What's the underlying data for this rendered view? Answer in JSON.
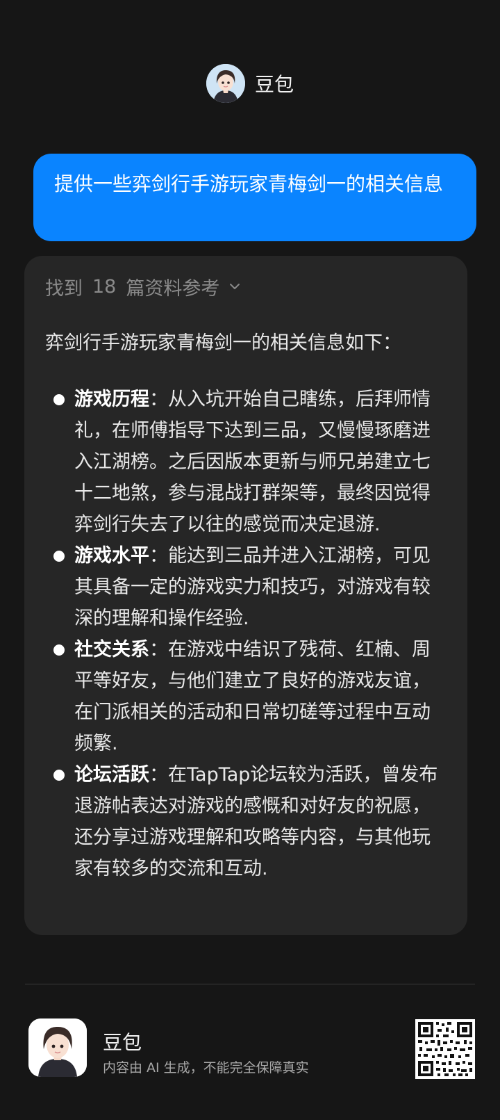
{
  "header": {
    "title": "豆包",
    "avatar_icon": "doubao-avatar-icon"
  },
  "user_message": {
    "text": "提供一些弈剑行手游玩家青梅剑一的相关信息"
  },
  "answer": {
    "refs": {
      "prefix": "找到",
      "count": "18",
      "suffix": "篇资料参考",
      "icon": "chevron-down-icon"
    },
    "intro": "弈剑行手游玩家青梅剑一的相关信息如下：",
    "bullets": [
      {
        "title": "游戏历程",
        "text": "：从入坑开始自己瞎练，后拜师情礼，在师傅指导下达到三品，又慢慢琢磨进入江湖榜。之后因版本更新与师兄弟建立七十二地煞，参与混战打群架等，最终因觉得弈剑行失去了以往的感觉而决定退游."
      },
      {
        "title": "游戏水平",
        "text": "：能达到三品并进入江湖榜，可见其具备一定的游戏实力和技巧，对游戏有较深的理解和操作经验."
      },
      {
        "title": "社交关系",
        "text": "：在游戏中结识了残荷、红楠、周平等好友，与他们建立了良好的游戏友谊，在门派相关的活动和日常切磋等过程中互动频繁."
      },
      {
        "title": "论坛活跃",
        "text": "：在TapTap论坛较为活跃，曾发布退游帖表达对游戏的感慨和对好友的祝愿，还分享过游戏理解和攻略等内容，与其他玩家有较多的交流和互动."
      }
    ]
  },
  "footer": {
    "name": "豆包",
    "note": "内容由 AI 生成，不能完全保障真实",
    "qr_icon": "qr-code-icon"
  },
  "colors": {
    "background": "#161616",
    "user_bubble": "#0a84ff",
    "card": "#262626"
  }
}
